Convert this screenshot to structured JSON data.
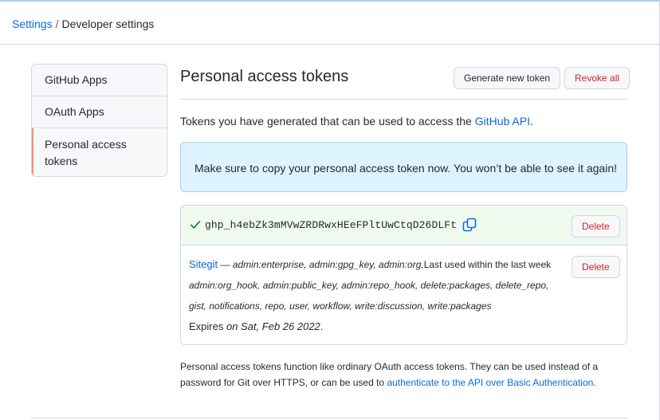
{
  "breadcrumb": {
    "parent": "Settings",
    "separator": "/",
    "current": "Developer settings"
  },
  "sidebar": {
    "items": [
      {
        "label": "GitHub Apps"
      },
      {
        "label": "OAuth Apps"
      },
      {
        "label": "Personal access tokens",
        "selected": true
      }
    ]
  },
  "main": {
    "title": "Personal access tokens",
    "generate_label": "Generate new token",
    "revoke_label": "Revoke all",
    "intro_text": "Tokens you have generated that can be used to access the ",
    "intro_link": "GitHub API",
    "intro_end": ".",
    "flash": "Make sure to copy your personal access token now. You won’t be able to see it again!",
    "new_token": {
      "value": "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",
      "delete_label": "Delete"
    },
    "token": {
      "name": "Sitegit",
      "dash": " — ",
      "scopes": "admin:enterprise, admin:gpg_key, admin:org,",
      "last_used": "Last used within the last week",
      "scopes_2": "admin:org_hook, admin:public_key, admin:repo_hook, delete:packages, delete_repo,",
      "scopes_3": "gist, notifications, repo, user, workflow, write:discussion, write:packages",
      "expires_prefix": "Expires",
      "expires_on": " on Sat, Feb 26 2022",
      "expires_end": ".",
      "delete_label": "Delete"
    },
    "note_text": "Personal access tokens function like ordinary OAuth access tokens. They can be used instead of a password for Git over HTTPS, or can be used to ",
    "note_link": "authenticate to the API over Basic Authentication",
    "note_end": "."
  },
  "colors": {
    "link": "#0969da",
    "danger": "#cf222e",
    "flash_bg": "#ddf4ff",
    "new_token_bg": "#f0f9ed",
    "selected_marker": "#fd8c73",
    "success": "#1a7f37"
  },
  "icons": {
    "check": "check-icon",
    "copy": "copy-icon"
  }
}
